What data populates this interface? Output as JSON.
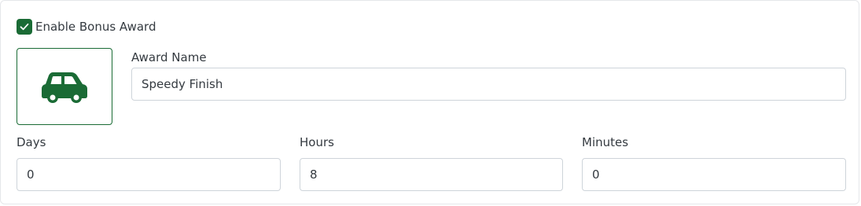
{
  "enable_bonus": {
    "checked": true,
    "label": "Enable Bonus Award"
  },
  "award_icon": "car-icon",
  "award_name": {
    "label": "Award Name",
    "value": "Speedy Finish"
  },
  "duration": {
    "days": {
      "label": "Days",
      "value": "0"
    },
    "hours": {
      "label": "Hours",
      "value": "8"
    },
    "minutes": {
      "label": "Minutes",
      "value": "0"
    }
  },
  "colors": {
    "accent": "#1a6b35",
    "border": "#ced4da",
    "text": "#343a40"
  }
}
